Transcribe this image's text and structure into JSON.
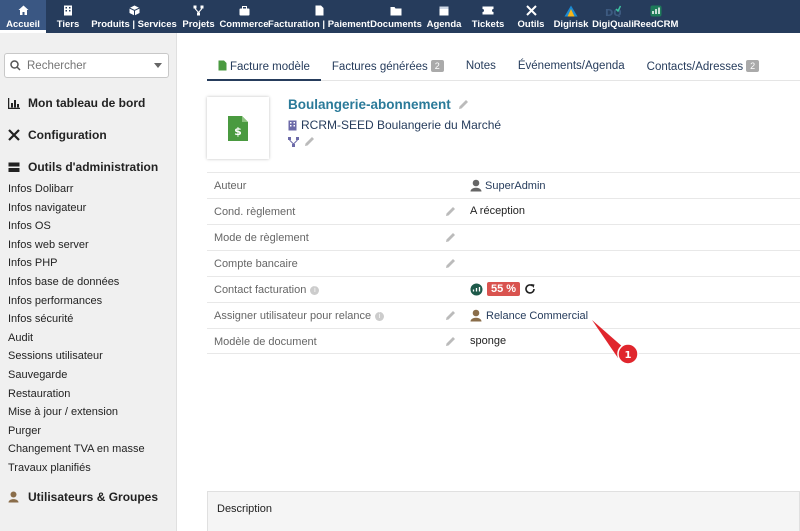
{
  "topbar": {
    "items": [
      {
        "label": "Accueil",
        "icon": "home-icon"
      },
      {
        "label": "Tiers",
        "icon": "building-icon"
      },
      {
        "label": "Produits | Services",
        "icon": "cube-icon"
      },
      {
        "label": "Projets",
        "icon": "sitemap-icon"
      },
      {
        "label": "Commerce",
        "icon": "briefcase-icon"
      },
      {
        "label": "Facturation | Paiement",
        "icon": "invoice-icon"
      },
      {
        "label": "Documents",
        "icon": "folder-icon"
      },
      {
        "label": "Agenda",
        "icon": "calendar-icon"
      },
      {
        "label": "Tickets",
        "icon": "ticket-icon"
      },
      {
        "label": "Outils",
        "icon": "tools-icon"
      },
      {
        "label": "Digirisk",
        "icon": "digirisk-logo-icon"
      },
      {
        "label": "DigiQuali",
        "icon": "digiquali-logo-icon"
      },
      {
        "label": "ReedCRM",
        "icon": "reedcrm-logo-icon"
      }
    ]
  },
  "sidebar": {
    "search_placeholder": "Rechercher",
    "dashboard": "Mon tableau de bord",
    "configuration": "Configuration",
    "admin_tools": "Outils d'administration",
    "links": [
      "Infos Dolibarr",
      "Infos navigateur",
      "Infos OS",
      "Infos web server",
      "Infos PHP",
      "Infos base de données",
      "Infos performances",
      "Infos sécurité",
      "Audit",
      "Sessions utilisateur",
      "Sauvegarde",
      "Restauration",
      "Mise à jour / extension",
      "Purger",
      "Changement TVA en masse",
      "Travaux planifiés"
    ],
    "users_groups": "Utilisateurs & Groupes"
  },
  "tabs": [
    {
      "label": "Facture modèle",
      "badge": ""
    },
    {
      "label": "Factures générées",
      "badge": "2"
    },
    {
      "label": "Notes",
      "badge": ""
    },
    {
      "label": "Événements/Agenda",
      "badge": ""
    },
    {
      "label": "Contacts/Adresses",
      "badge": "2"
    }
  ],
  "header": {
    "ref": "Boulangerie-abonnement",
    "thirdparty": "RCRM-SEED Boulangerie du Marché"
  },
  "fields": {
    "author": {
      "label": "Auteur",
      "value": "SuperAdmin"
    },
    "payment_terms": {
      "label": "Cond. règlement",
      "value": "A réception"
    },
    "payment_mode": {
      "label": "Mode de règlement",
      "value": ""
    },
    "bank_account": {
      "label": "Compte bancaire",
      "value": ""
    },
    "billing_contact": {
      "label": "Contact facturation",
      "percent": "55 %"
    },
    "reminder_user": {
      "label": "Assigner utilisateur pour relance",
      "value": "Relance Commercial"
    },
    "doc_model": {
      "label": "Modèle de document",
      "value": "sponge"
    }
  },
  "description_label": "Description",
  "annotation": {
    "number": "1",
    "color": "#e0262d"
  },
  "colors": {
    "topbar": "#263c5c",
    "accent_green": "#4a9a40",
    "danger": "#d9534f",
    "link": "#263c5c"
  }
}
